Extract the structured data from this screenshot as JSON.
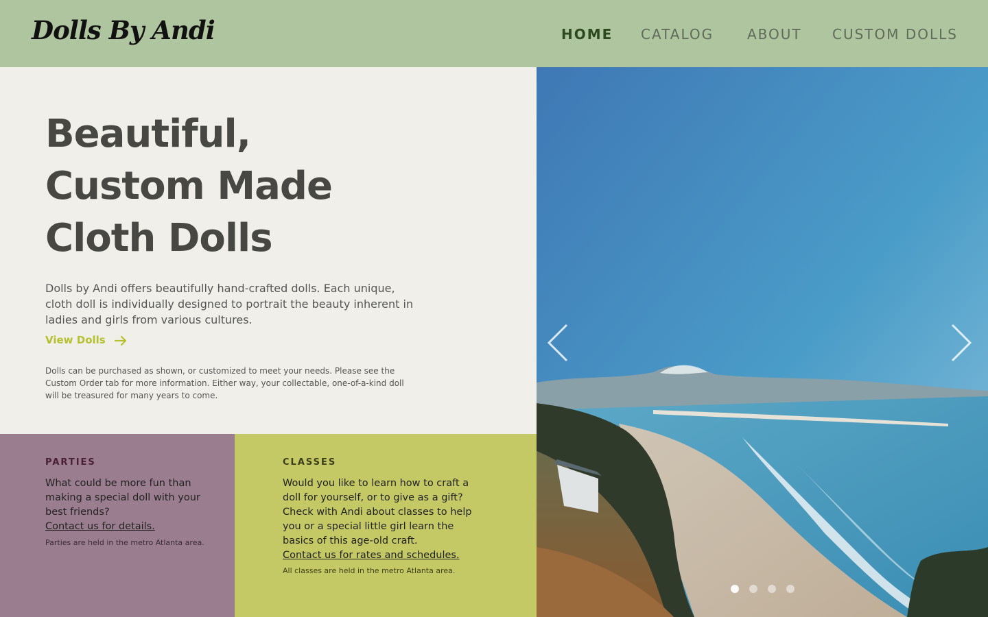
{
  "header": {
    "logo": "Dolls By Andi",
    "nav": {
      "home": "HOME",
      "catalog": "CATALOG",
      "about": "ABOUT",
      "custom": "CUSTOM DOLLS"
    },
    "active_nav": "HOME"
  },
  "hero": {
    "title_lines": [
      "Beautiful,",
      "Custom Made",
      "Cloth Dolls"
    ],
    "intro": "Dolls by Andi offers beautifully hand-crafted dolls.  Each unique, cloth doll is individually designed to portrait the beauty inherent in ladies and girls from various cultures.",
    "cta": "View Dolls",
    "note": "Dolls can be purchased as shown, or customized to meet your needs.  Please see the Custom Order tab for more information.  Either way, your collectable, one-of-a-kind doll will be treasured for many years to come."
  },
  "parties": {
    "heading": "PARTIES",
    "text": "What could be more fun than making a special doll with your best friends?",
    "link": "Contact us for details.",
    "fine": "Parties are held in the metro Atlanta area."
  },
  "classes": {
    "heading": "CLASSES",
    "text": "Would you like to learn how to craft a doll for yourself, or to give as a gift? Check with Andi about classes to help you or a special little girl learn the basics of this age-old craft.",
    "link": "Contact us for rates and schedules.",
    "fine": "All classes are held in the metro Atlanta area."
  },
  "slider": {
    "slide_count": 4,
    "active_slide": 1,
    "image": "coastal-beach-photo"
  },
  "colors": {
    "header_bg": "#afc59f",
    "hero_bg": "#f0efe9",
    "accent_green": "#b6c131",
    "parties_bg": "#9a7d8e",
    "classes_bg": "#c4c966",
    "nav_active": "#2c4a1d"
  }
}
